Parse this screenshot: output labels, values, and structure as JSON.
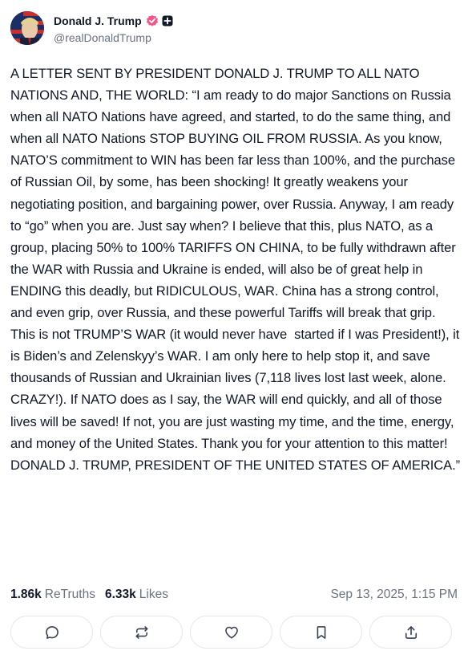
{
  "author": {
    "display_name": "Donald J. Trump",
    "handle": "@realDonaldTrump",
    "avatar_icon": "avatar-portrait",
    "verified_icon": "verified-badge-icon",
    "verified_color": "#f0568a",
    "plus_icon": "plus-badge-icon"
  },
  "post": {
    "text": "A LETTER SENT BY PRESIDENT DONALD J. TRUMP TO ALL NATO NATIONS AND, THE WORLD: “I am ready to do major Sanctions on Russia when all NATO Nations have agreed, and started, to do the same thing, and when all NATO Nations STOP BUYING OIL FROM RUSSIA. As you know, NATO’S commitment to WIN has been far less than 100%, and the purchase of Russian Oil, by some, has been shocking! It greatly weakens your negotiating position, and bargaining power, over Russia. Anyway, I am ready to “go” when you are. Just say when? I believe that this, plus NATO, as a group, placing 50% to 100% TARIFFS ON CHINA, to be fully withdrawn after the WAR with Russia and Ukraine is ended, will also be of great help in ENDING this deadly, but RIDICULOUS, WAR. China has a strong control, and even grip, over Russia, and these powerful Tariffs will break that grip. This is not TRUMP’S WAR (it would never have  started if I was President!), it is Biden’s and Zelenskyy’s WAR. I am only here to help stop it, and save thousands of Russian and Ukrainian lives (7,118 lives lost last week, alone. CRAZY!). If NATO does as I say, the WAR will end quickly, and all of those lives will be saved! If not, you are just wasting my time, and the time, energy, and money of the United States. Thank you for your attention to this matter! DONALD J. TRUMP, PRESIDENT OF THE UNITED STATES OF AMERICA.”"
  },
  "stats": {
    "retruths_count": "1.86k",
    "retruths_label": "ReTruths",
    "likes_count": "6.33k",
    "likes_label": "Likes",
    "timestamp": "Sep 13, 2025, 1:15 PM"
  },
  "actions": [
    {
      "icon": "reply-icon"
    },
    {
      "icon": "retruth-icon"
    },
    {
      "icon": "like-icon"
    },
    {
      "icon": "bookmark-icon"
    },
    {
      "icon": "share-icon"
    }
  ],
  "colors": {
    "text": "#111827",
    "muted": "#6b7280",
    "border": "#e5e7eb"
  }
}
